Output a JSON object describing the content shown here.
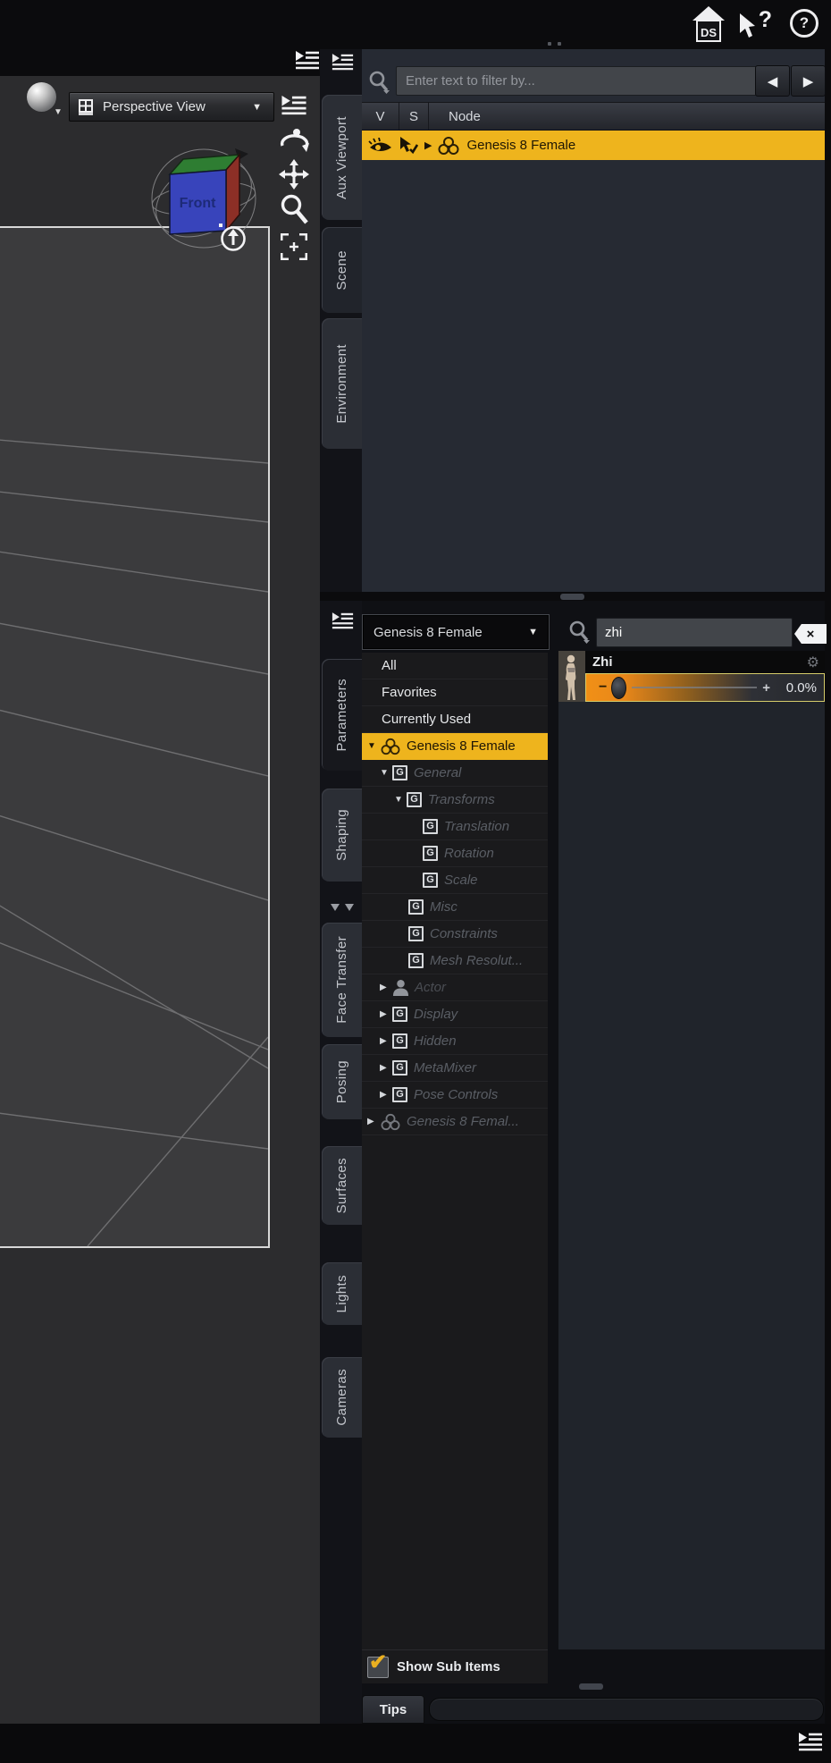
{
  "titlebar": {
    "ds_home_label": "DS",
    "context_help_glyph": "?",
    "help_glyph": "?"
  },
  "viewport": {
    "camera_selector": {
      "label": "Perspective View"
    },
    "view_cube": {
      "front_label": "Front"
    }
  },
  "scene_pane": {
    "tabs": [
      {
        "label": "Aux Viewport",
        "active": false
      },
      {
        "label": "Scene",
        "active": true
      },
      {
        "label": "Environment",
        "active": false
      }
    ],
    "filter_placeholder": "Enter text to filter by...",
    "columns": {
      "visibility": "V",
      "selection": "S",
      "node": "Node"
    },
    "nodes": [
      {
        "label": "Genesis 8 Female",
        "selected": true,
        "expander": "collapsed"
      }
    ]
  },
  "parameters_pane": {
    "tabs": [
      {
        "label": "Parameters",
        "active": true
      },
      {
        "label": "Shaping",
        "active": false
      },
      {
        "label": "Face Transfer",
        "active": false
      },
      {
        "label": "Posing",
        "active": false
      },
      {
        "label": "Surfaces",
        "active": false
      },
      {
        "label": "Lights",
        "active": false
      },
      {
        "label": "Cameras",
        "active": false
      }
    ],
    "scope_selector": {
      "value": "Genesis 8 Female"
    },
    "search": {
      "value": "zhi"
    },
    "group_icon_letter": "G",
    "groups": [
      {
        "label": "All",
        "level": 0,
        "kind": "plain"
      },
      {
        "label": "Favorites",
        "level": 0,
        "kind": "plain"
      },
      {
        "label": "Currently Used",
        "level": 0,
        "kind": "plain"
      },
      {
        "label": "Genesis 8 Female",
        "level": 0,
        "kind": "node",
        "expander": "expanded",
        "selected": true
      },
      {
        "label": "General",
        "level": 1,
        "kind": "group",
        "expander": "expanded",
        "dim": true
      },
      {
        "label": "Transforms",
        "level": 2,
        "kind": "group",
        "expander": "expanded",
        "dim": true
      },
      {
        "label": "Translation",
        "level": 3,
        "kind": "group",
        "dim": true
      },
      {
        "label": "Rotation",
        "level": 3,
        "kind": "group",
        "dim": true
      },
      {
        "label": "Scale",
        "level": 3,
        "kind": "group",
        "dim": true
      },
      {
        "label": "Misc",
        "level": 2,
        "kind": "group",
        "dim": true
      },
      {
        "label": "Constraints",
        "level": 2,
        "kind": "group",
        "dim": true
      },
      {
        "label": "Mesh Resolut...",
        "level": 2,
        "kind": "group",
        "dim": true
      },
      {
        "label": "Actor",
        "level": 1,
        "kind": "person",
        "expander": "collapsed",
        "dim": true
      },
      {
        "label": "Display",
        "level": 1,
        "kind": "group",
        "expander": "collapsed",
        "dim": true
      },
      {
        "label": "Hidden",
        "level": 1,
        "kind": "group",
        "expander": "collapsed",
        "dim": true
      },
      {
        "label": "MetaMixer",
        "level": 1,
        "kind": "group",
        "expander": "collapsed",
        "dim": true
      },
      {
        "label": "Pose Controls",
        "level": 1,
        "kind": "group",
        "expander": "collapsed",
        "dim": true
      },
      {
        "label": "Genesis 8 Femal...",
        "level": 0,
        "kind": "node",
        "expander": "collapsed",
        "dim": true
      }
    ],
    "parameter_card": {
      "name": "Zhi",
      "value": "0.0%"
    },
    "show_sub_items": {
      "label": "Show Sub Items",
      "checked": true
    },
    "footer": {
      "tips_label": "Tips"
    }
  },
  "glyphs": {
    "dropdown": "▼",
    "expanded": "▼",
    "collapsed": "▶",
    "back": "◀",
    "forward": "▶",
    "gear": "⚙",
    "check": "✔",
    "clear": "×",
    "minus": "−",
    "plus": "+"
  },
  "colors": {
    "accent": "#eeb41d",
    "panel": "#262a33",
    "slider_border": "#d5cc6a",
    "slider_orange": "#f19016"
  }
}
